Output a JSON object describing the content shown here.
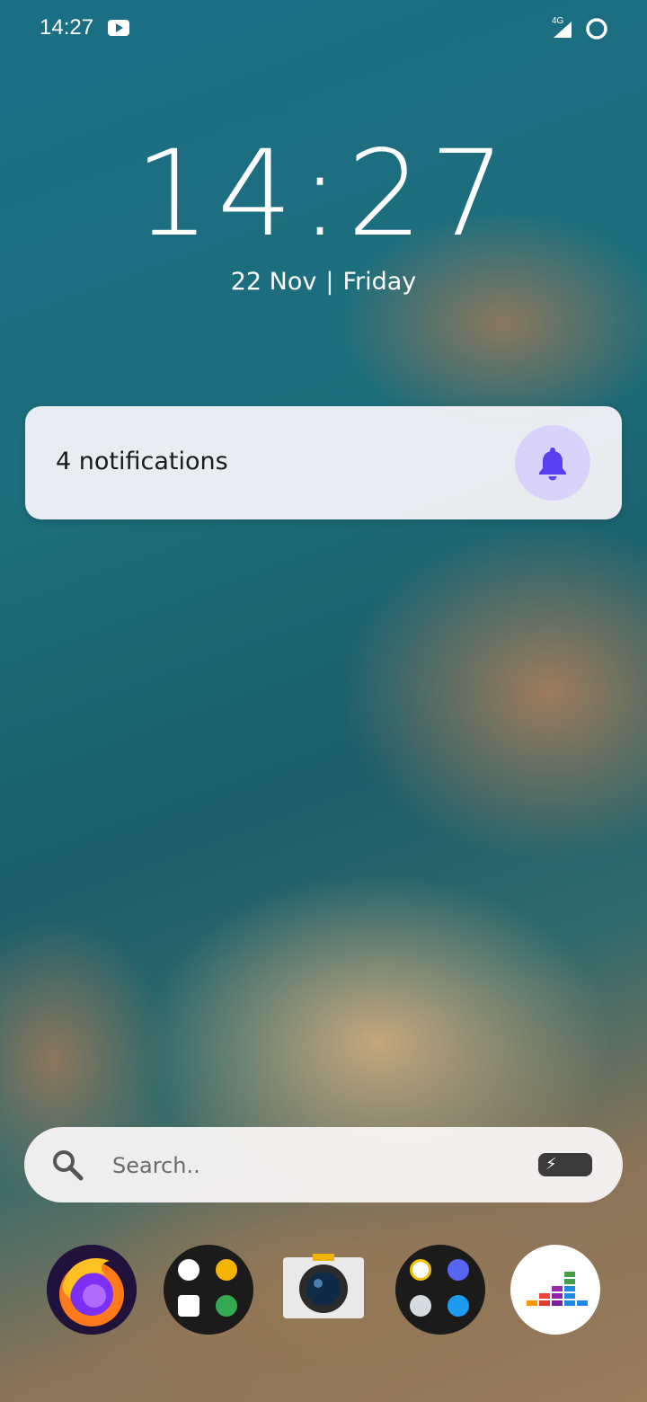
{
  "status_bar": {
    "time": "14:27",
    "network": "4G",
    "icons": [
      "youtube-icon",
      "signal-icon",
      "sync-icon"
    ]
  },
  "lockscreen": {
    "clock": "14:27",
    "date": "22 Nov",
    "day": "Friday"
  },
  "notification_card": {
    "text": "4 notifications",
    "icon": "bell-icon",
    "accent": "#5b3ff2"
  },
  "search": {
    "placeholder": "Search.."
  },
  "dock": {
    "items": [
      {
        "name": "Firefox",
        "icon": "firefox-icon"
      },
      {
        "name": "Folder",
        "icon": "folder-icon",
        "apps": [
          "play-store-icon",
          "bulb-icon",
          "calendar-icon",
          "maps-icon"
        ]
      },
      {
        "name": "Camera",
        "icon": "camera-icon"
      },
      {
        "name": "Folder",
        "icon": "folder-icon",
        "apps": [
          "photos-icon",
          "discord-icon",
          "telegram-icon",
          "twitter-icon"
        ]
      },
      {
        "name": "Deezer",
        "icon": "deezer-icon"
      }
    ]
  }
}
